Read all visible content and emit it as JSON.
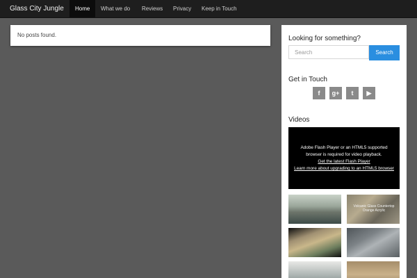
{
  "navbar": {
    "brand": "Glass City Jungle",
    "items": [
      {
        "label": "Home",
        "active": true
      },
      {
        "label": "What we do",
        "active": false
      },
      {
        "label": "Reviews",
        "active": false
      },
      {
        "label": "Privacy",
        "active": false
      },
      {
        "label": "Keep in Touch",
        "active": false
      }
    ]
  },
  "main": {
    "empty_message": "No posts found."
  },
  "sidebar": {
    "search": {
      "title": "Looking for something?",
      "placeholder": "Search",
      "button_label": "Search"
    },
    "touch": {
      "title": "Get in Touch",
      "icons": [
        "facebook-icon",
        "google-plus-icon",
        "twitter-icon",
        "youtube-icon"
      ],
      "icon_glyphs": [
        "f",
        "g+",
        "t",
        "▶"
      ]
    },
    "videos": {
      "title": "Videos",
      "player_message_line1": "Adobe Flash Player or an HTML5 supported",
      "player_message_line2": "browser is required for video playback.",
      "player_link1": "Get the latest Flash Player",
      "player_link2": "Learn more about upgrading to an HTML5 browser",
      "thumbnail_caption": "Volcanic Glass Countertop Orange Acrylic"
    }
  },
  "colors": {
    "accent": "#2a8ee0",
    "navbar": "#1e1e1e",
    "background": "#5a5a5a"
  }
}
